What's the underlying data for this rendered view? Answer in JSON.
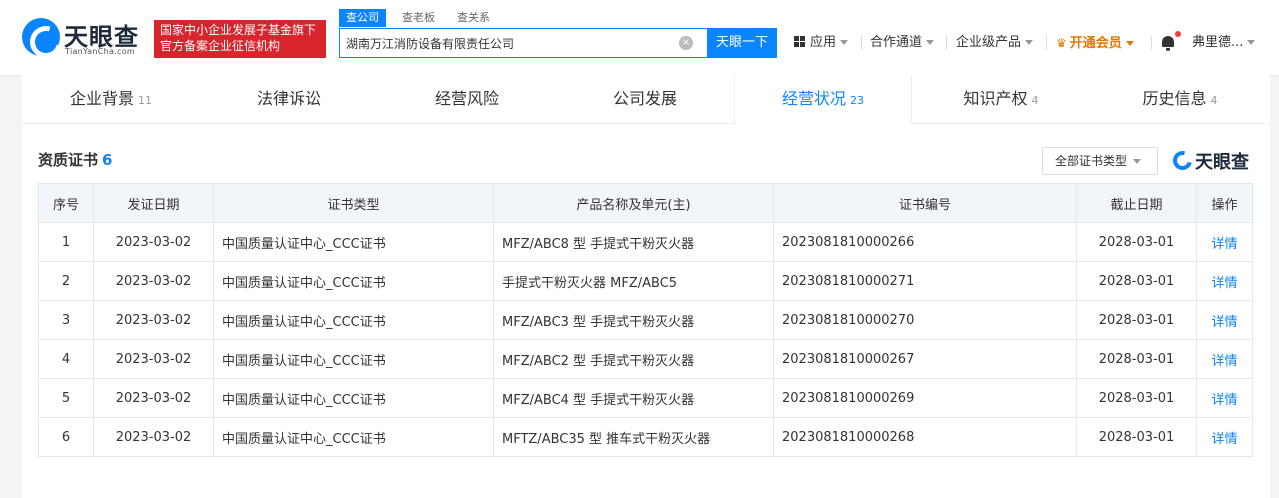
{
  "header": {
    "logo_text": "天眼查",
    "logo_sub": "TianYanCha.com",
    "banner_line1": "国家中小企业发展子基金旗下",
    "banner_line2": "官方备案企业征信机构",
    "search_tabs": [
      "查公司",
      "查老板",
      "查关系"
    ],
    "search_value": "湖南万江消防设备有限责任公司",
    "search_button": "天眼一下",
    "nav": {
      "apps": "应用",
      "cooperation": "合作通道",
      "enterprise": "企业级产品",
      "vip": "开通会员",
      "user": "弗里德..."
    }
  },
  "tabs": [
    {
      "label": "企业背景",
      "count": "11"
    },
    {
      "label": "法律诉讼",
      "count": ""
    },
    {
      "label": "经营风险",
      "count": ""
    },
    {
      "label": "公司发展",
      "count": ""
    },
    {
      "label": "经营状况",
      "count": "23"
    },
    {
      "label": "知识产权",
      "count": "4"
    },
    {
      "label": "历史信息",
      "count": "4"
    }
  ],
  "section": {
    "title": "资质证书",
    "count": "6",
    "filter_label": "全部证书类型",
    "watermark": "天眼查"
  },
  "table": {
    "headers": [
      "序号",
      "发证日期",
      "证书类型",
      "产品名称及单元(主)",
      "证书编号",
      "截止日期",
      "操作"
    ],
    "rows": [
      [
        "1",
        "2023-03-02",
        "中国质量认证中心_CCC证书",
        "MFZ/ABC8 型 手提式干粉灭火器",
        "2023081810000266",
        "2028-03-01",
        "详情"
      ],
      [
        "2",
        "2023-03-02",
        "中国质量认证中心_CCC证书",
        "手提式干粉灭火器 MFZ/ABC5",
        "2023081810000271",
        "2028-03-01",
        "详情"
      ],
      [
        "3",
        "2023-03-02",
        "中国质量认证中心_CCC证书",
        "MFZ/ABC3 型 手提式干粉灭火器",
        "2023081810000270",
        "2028-03-01",
        "详情"
      ],
      [
        "4",
        "2023-03-02",
        "中国质量认证中心_CCC证书",
        "MFZ/ABC2 型 手提式干粉灭火器",
        "2023081810000267",
        "2028-03-01",
        "详情"
      ],
      [
        "5",
        "2023-03-02",
        "中国质量认证中心_CCC证书",
        "MFZ/ABC4 型 手提式干粉灭火器",
        "2023081810000269",
        "2028-03-01",
        "详情"
      ],
      [
        "6",
        "2023-03-02",
        "中国质量认证中心_CCC证书",
        "MFTZ/ABC35 型 推车式干粉灭火器",
        "2023081810000268",
        "2028-03-01",
        "详情"
      ]
    ]
  }
}
